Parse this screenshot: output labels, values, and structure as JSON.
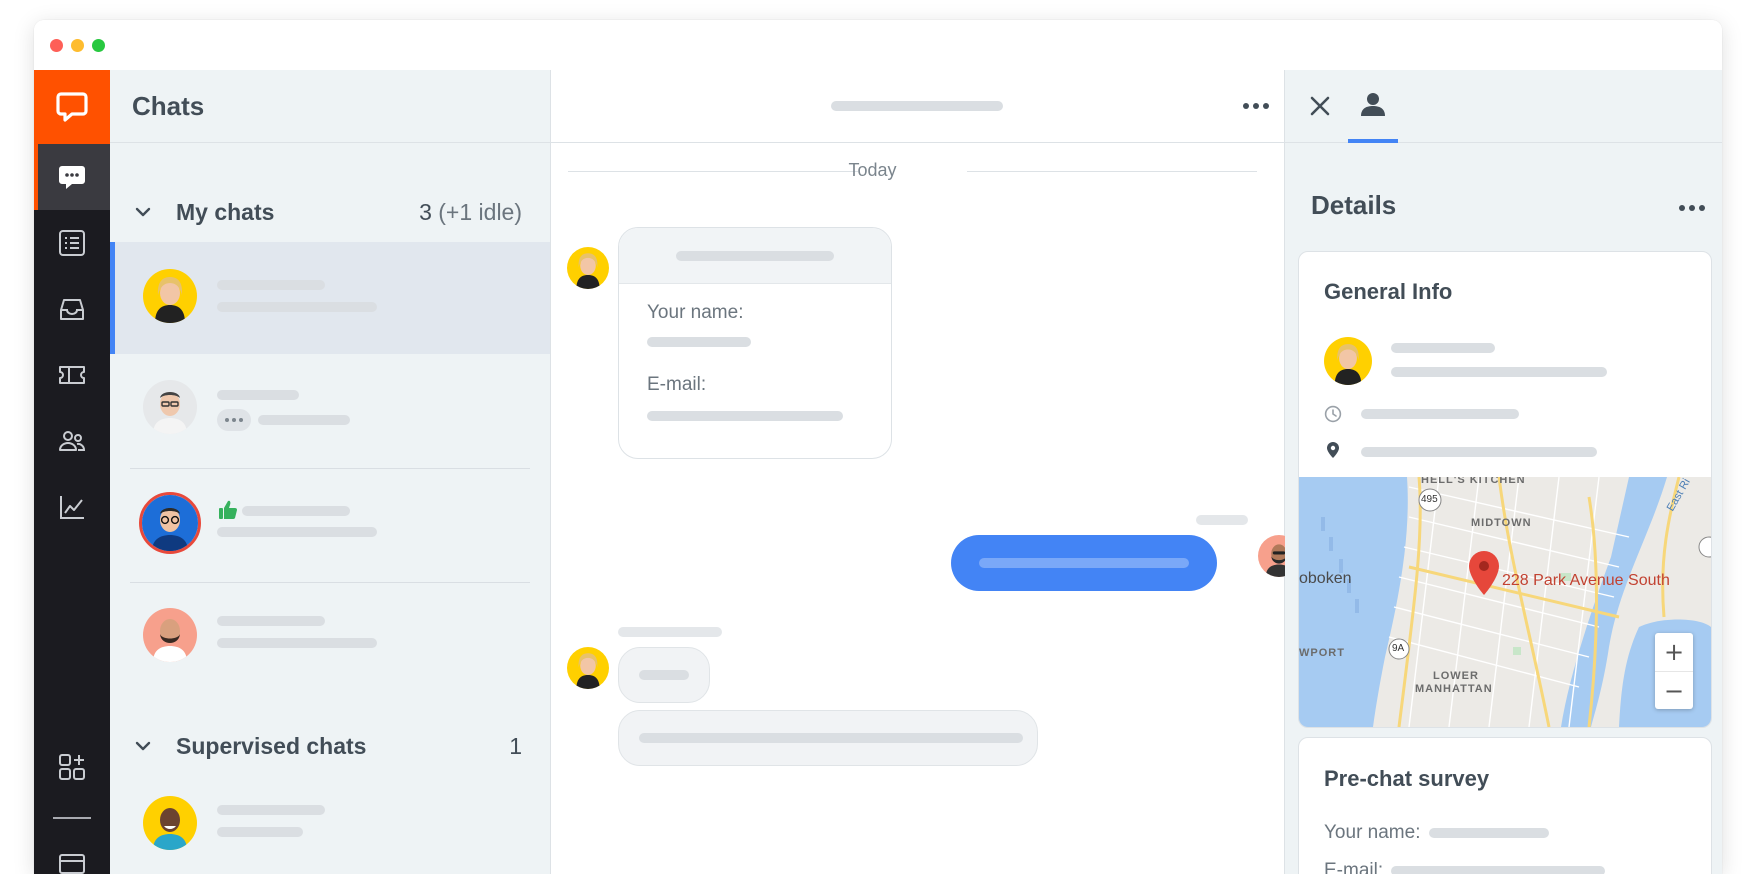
{
  "chats_panel": {
    "title": "Chats",
    "my_chats": {
      "label": "My chats",
      "count": "3",
      "idle": "(+1 idle)"
    },
    "supervised": {
      "label": "Supervised chats",
      "count": "1"
    }
  },
  "conversation": {
    "date_separator": "Today",
    "form": {
      "name_label": "Your name:",
      "email_label": "E-mail:"
    }
  },
  "details": {
    "title": "Details",
    "general_info": {
      "title": "General Info"
    },
    "map": {
      "pin_label": "228 Park Avenue South",
      "labels": [
        "HELL'S KITCHEN",
        "MIDTOWN",
        "oboken",
        "WPORT",
        "LOWER",
        "MANHATTAN",
        "East Ri",
        "495",
        "9A"
      ],
      "zoom_in": "+",
      "zoom_out": "−"
    },
    "prechat_survey": {
      "title": "Pre-chat survey",
      "name_label": "Your name:",
      "email_label": "E-mail:"
    }
  },
  "colors": {
    "brand": "#ff5100",
    "accent": "#4384f5",
    "sidebar": "#1b1b20",
    "avatar_yellow": "#ffd000",
    "avatar_salmon": "#f7a08c",
    "water": "#a6cbf2"
  }
}
